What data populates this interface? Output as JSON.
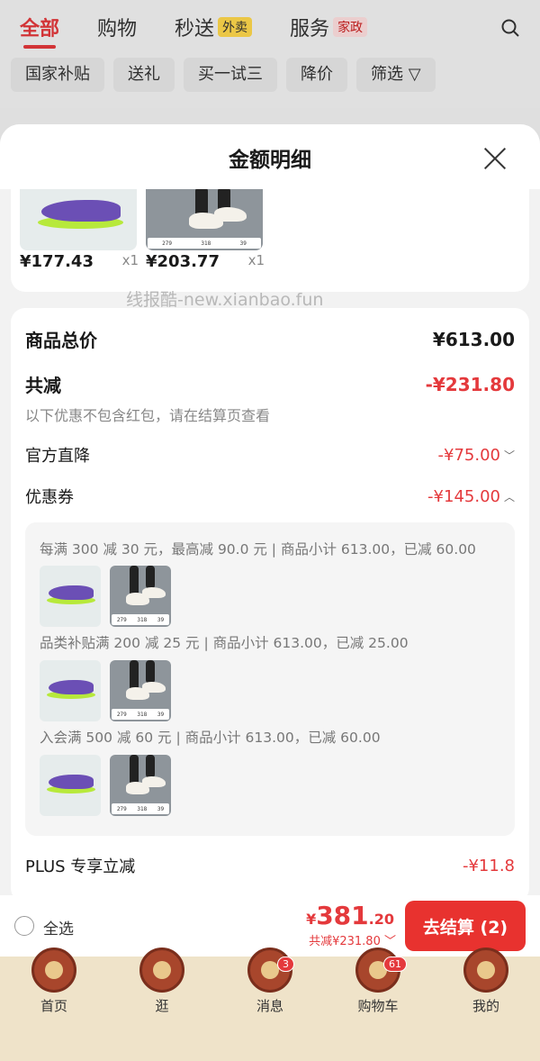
{
  "top_nav": {
    "tabs": [
      {
        "label": "全部",
        "badge": ""
      },
      {
        "label": "购物",
        "badge": ""
      },
      {
        "label": "秒送",
        "badge": "外卖"
      },
      {
        "label": "服务",
        "badge": "家政"
      }
    ],
    "chips": [
      "国家补贴",
      "送礼",
      "买一试三",
      "降价",
      "筛选 ▽"
    ]
  },
  "sheet": {
    "title": "金额明细",
    "products": [
      {
        "price": "¥177.43",
        "qty": "x1"
      },
      {
        "price": "¥203.77",
        "qty": "x1"
      }
    ],
    "watermark": "线报酷-new.xianbao.fun",
    "size_tag": [
      "279",
      "318",
      "39"
    ],
    "summary": {
      "total_label": "商品总价",
      "total_value": "¥613.00",
      "reduce_label": "共减",
      "reduce_value": "-¥231.80",
      "reduce_hint": "以下优惠不包含红包，请在结算页查看",
      "official_label": "官方直降",
      "official_value": "-¥75.00",
      "coupon_label": "优惠券",
      "coupon_value": "-¥145.00",
      "plus_label": "PLUS 专享立减",
      "plus_value": "-¥11.8"
    },
    "coupons": [
      {
        "text": "每满 300 减 30 元，最高减 90.0 元 | 商品小计 613.00，已减 60.00"
      },
      {
        "text": "品类补贴满 200 减 25 元 | 商品小计 613.00，已减 25.00"
      },
      {
        "text": "入会满 500 减 60 元 | 商品小计 613.00，已减 60.00"
      }
    ]
  },
  "checkout": {
    "select_all": "全选",
    "currency": "¥",
    "amount_int": "381",
    "amount_dec": ".20",
    "reduce_line": "共减¥231.80",
    "pay_label": "去结算 (2)"
  },
  "tabbar": {
    "items": [
      {
        "label": "首页",
        "badge": ""
      },
      {
        "label": "逛",
        "badge": ""
      },
      {
        "label": "消息",
        "badge": "3"
      },
      {
        "label": "购物车",
        "badge": "61"
      },
      {
        "label": "我的",
        "badge": ""
      }
    ]
  },
  "colors": {
    "accent": "#e4393c",
    "pay_button": "#e8322f",
    "tabbar_bg": "#efe3c9"
  }
}
